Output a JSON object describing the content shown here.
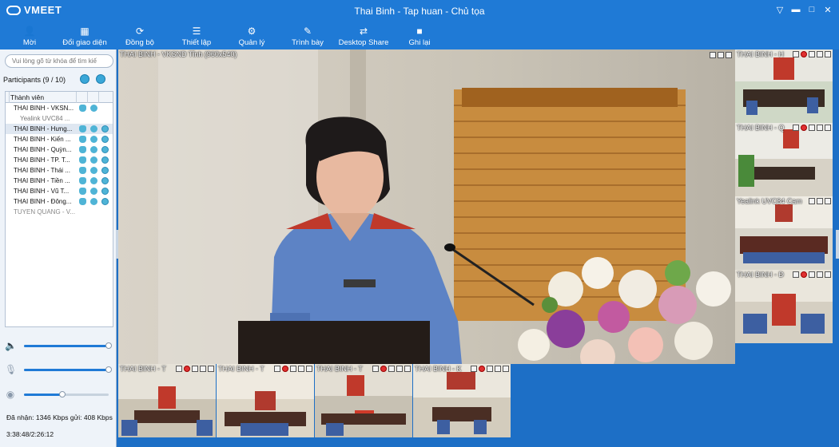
{
  "window": {
    "app_name": "VMEET",
    "title": "Thai Binh - Tap huan - Chủ tọa"
  },
  "toolbar": [
    {
      "label": "Mời",
      "icon": "invite-icon"
    },
    {
      "label": "Đổi giao diện",
      "icon": "layout-icon"
    },
    {
      "label": "Đồng bộ",
      "icon": "sync-icon"
    },
    {
      "label": "Thiết lập",
      "icon": "settings-sliders-icon"
    },
    {
      "label": "Quản lý",
      "icon": "manage-gears-icon"
    },
    {
      "label": "Trình bày",
      "icon": "present-icon"
    },
    {
      "label": "Desktop Share",
      "icon": "desktop-share-icon"
    },
    {
      "label": "Ghi lại",
      "icon": "record-icon"
    }
  ],
  "sidebar": {
    "search_placeholder": "Vui lòng gõ từ khóa để tìm kiế",
    "participants_label": "Participants (9 / 10)",
    "column_header": "Thành viên",
    "participants": [
      {
        "name": "THAI BINH - VKSN...",
        "type": "main"
      },
      {
        "name": "Yealink UVC84 ...",
        "type": "sub"
      },
      {
        "name": "THAI BINH - Hưng...",
        "type": "sel"
      },
      {
        "name": "THAI BINH - Kiến ...",
        "type": "main"
      },
      {
        "name": "THAI BINH - Quỳn...",
        "type": "main"
      },
      {
        "name": "THAI BINH - TP. T...",
        "type": "main"
      },
      {
        "name": "THAI BINH - Thái ...",
        "type": "main"
      },
      {
        "name": "THAI BINH - Tiền ...",
        "type": "main"
      },
      {
        "name": "THAI BINH - Vũ T...",
        "type": "main"
      },
      {
        "name": "THAI BINH - Đông...",
        "type": "main"
      },
      {
        "name": "TUYEN QUANG - V...",
        "type": "dim"
      }
    ],
    "speaker_level": 1.0,
    "mic_level": 1.0,
    "camera_level": 0.45,
    "bandwidth": "Đã nhận: 1346 Kbps gửi: 408 Kbps",
    "elapsed": "3:38:48/2:26:12"
  },
  "main_video": {
    "label": "THAI BINH - VKSND Tỉnh (960x540)"
  },
  "right_thumbs": [
    {
      "label": "THAI BINH - H"
    },
    {
      "label": "THAI BINH - Q"
    },
    {
      "label": "Yealink UVC84 Cam"
    },
    {
      "label": "THAI BINH - Đ"
    }
  ],
  "bottom_thumbs": [
    {
      "label": "THAI BINH - T"
    },
    {
      "label": "THAI BINH - T"
    },
    {
      "label": "THAI BINH - T"
    },
    {
      "label": "THAI BINH - K"
    }
  ],
  "colors": {
    "brand_blue": "#1f7ad6",
    "panel_bg": "#eef3f9",
    "status_icon": "#4fb4d6"
  }
}
